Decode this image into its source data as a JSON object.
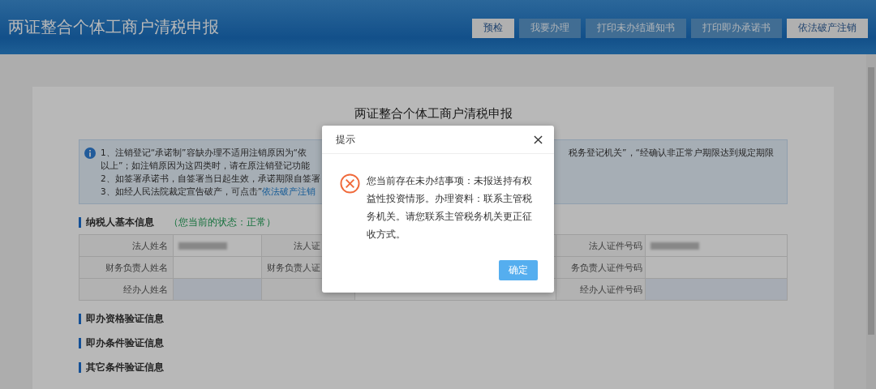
{
  "header": {
    "title": "两证整合个体工商户清税申报",
    "buttons": [
      {
        "label": "预检",
        "disabled": false
      },
      {
        "label": "我要办理",
        "disabled": true
      },
      {
        "label": "打印未办结通知书",
        "disabled": true
      },
      {
        "label": "打印即办承诺书",
        "disabled": true
      },
      {
        "label": "依法破产注销",
        "disabled": false
      }
    ]
  },
  "form": {
    "title": "两证整合个体工商户清税申报",
    "notice": [
      {
        "left": "1、注销登记“承诺制”容缺办理不适用注销原因为“依",
        "right": "税务登记机关”，“经确认非正常户期限达到规定期限"
      },
      {
        "left": "以上”；如注销原因为这四类时，请在原注销登记功能"
      },
      {
        "left": "2、如签署承诺书，自签署当日起生效，承诺期限自签署"
      },
      {
        "left": "3、如经人民法院裁定宣告破产，可点击”",
        "link": "依法破产注销"
      }
    ],
    "basic_info": {
      "heading": "纳税人基本信息",
      "status": "（您当前的状态：正常）",
      "rows": [
        {
          "cells": [
            {
              "kind": "label",
              "text": "法人姓名"
            },
            {
              "kind": "redacted"
            },
            {
              "kind": "label",
              "text": "法人证"
            },
            {
              "kind": "empty"
            },
            {
              "kind": "label",
              "text": "法人证件号码"
            },
            {
              "kind": "redacted"
            }
          ]
        },
        {
          "cells": [
            {
              "kind": "label",
              "text": "财务负责人姓名"
            },
            {
              "kind": "empty"
            },
            {
              "kind": "label",
              "text": "财务负责人证"
            },
            {
              "kind": "empty"
            },
            {
              "kind": "label",
              "text": "务负责人证件号码"
            },
            {
              "kind": "empty"
            }
          ]
        },
        {
          "cells": [
            {
              "kind": "label",
              "text": "经办人姓名"
            },
            {
              "kind": "input"
            },
            {
              "kind": "label"
            },
            {
              "kind": "empty"
            },
            {
              "kind": "label",
              "text": "经办人证件号码"
            },
            {
              "kind": "input"
            }
          ]
        }
      ]
    },
    "sections": [
      "即办资格验证信息",
      "即办条件验证信息",
      "其它条件验证信息"
    ]
  },
  "dialog": {
    "title": "提示",
    "message": "您当前存在未办结事项：未报送持有权益性投资情形。办理资料：联系主管税务机关。请您联系主管税务机关更正征收方式。",
    "confirm": "确定"
  }
}
